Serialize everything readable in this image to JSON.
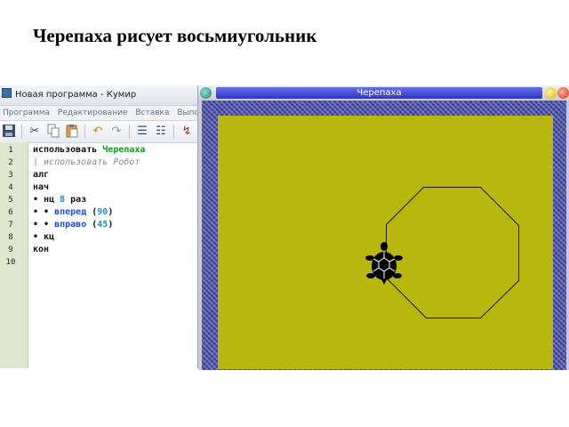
{
  "slide": {
    "title": "Черепаха рисует восьмиугольник"
  },
  "editor": {
    "window_title": "Новая программа - Кумир",
    "menu": [
      "Программа",
      "Редактирование",
      "Вставка",
      "Выполнение"
    ],
    "toolbar_icons": [
      "save-icon",
      "cut-icon",
      "copy-icon",
      "paste-icon",
      "undo-icon",
      "redo-icon",
      "indent-icon",
      "unindent-icon",
      "run-icon"
    ],
    "line_numbers": [
      "1",
      "2",
      "3",
      "4",
      "5",
      "6",
      "7",
      "8",
      "9",
      "10"
    ],
    "lines": [
      {
        "t1": "использовать ",
        "t2": "Черепаха"
      },
      {
        "comment": "| использовать Робот"
      },
      {
        "text": "алг"
      },
      {
        "text": "нач"
      },
      {
        "dots": "• ",
        "k1": "нц ",
        "num": "8",
        "k2": " раз"
      },
      {
        "dots": "• • ",
        "cmd": "вперед",
        "open": " (",
        "num": "90",
        "close": ")"
      },
      {
        "dots": "• • ",
        "cmd": "вправо",
        "open": " (",
        "num": "45",
        "close": ")"
      },
      {
        "dots": "• ",
        "text": "кц"
      },
      {
        "text": "кон"
      }
    ],
    "colors": {
      "keyword_green": "#1a9a1a",
      "command_blue": "#1d4fd6",
      "number": "#1e8fcf",
      "gutter": "#dfe7ce"
    }
  },
  "turtle_window": {
    "title": "Черепаха",
    "colors": {
      "canvas": "#b8b70f",
      "frame": "#4a4fb2",
      "titlebar": "#2f36c4"
    },
    "program": {
      "repeat": 8,
      "forward": 90,
      "turn_right": 45
    }
  }
}
